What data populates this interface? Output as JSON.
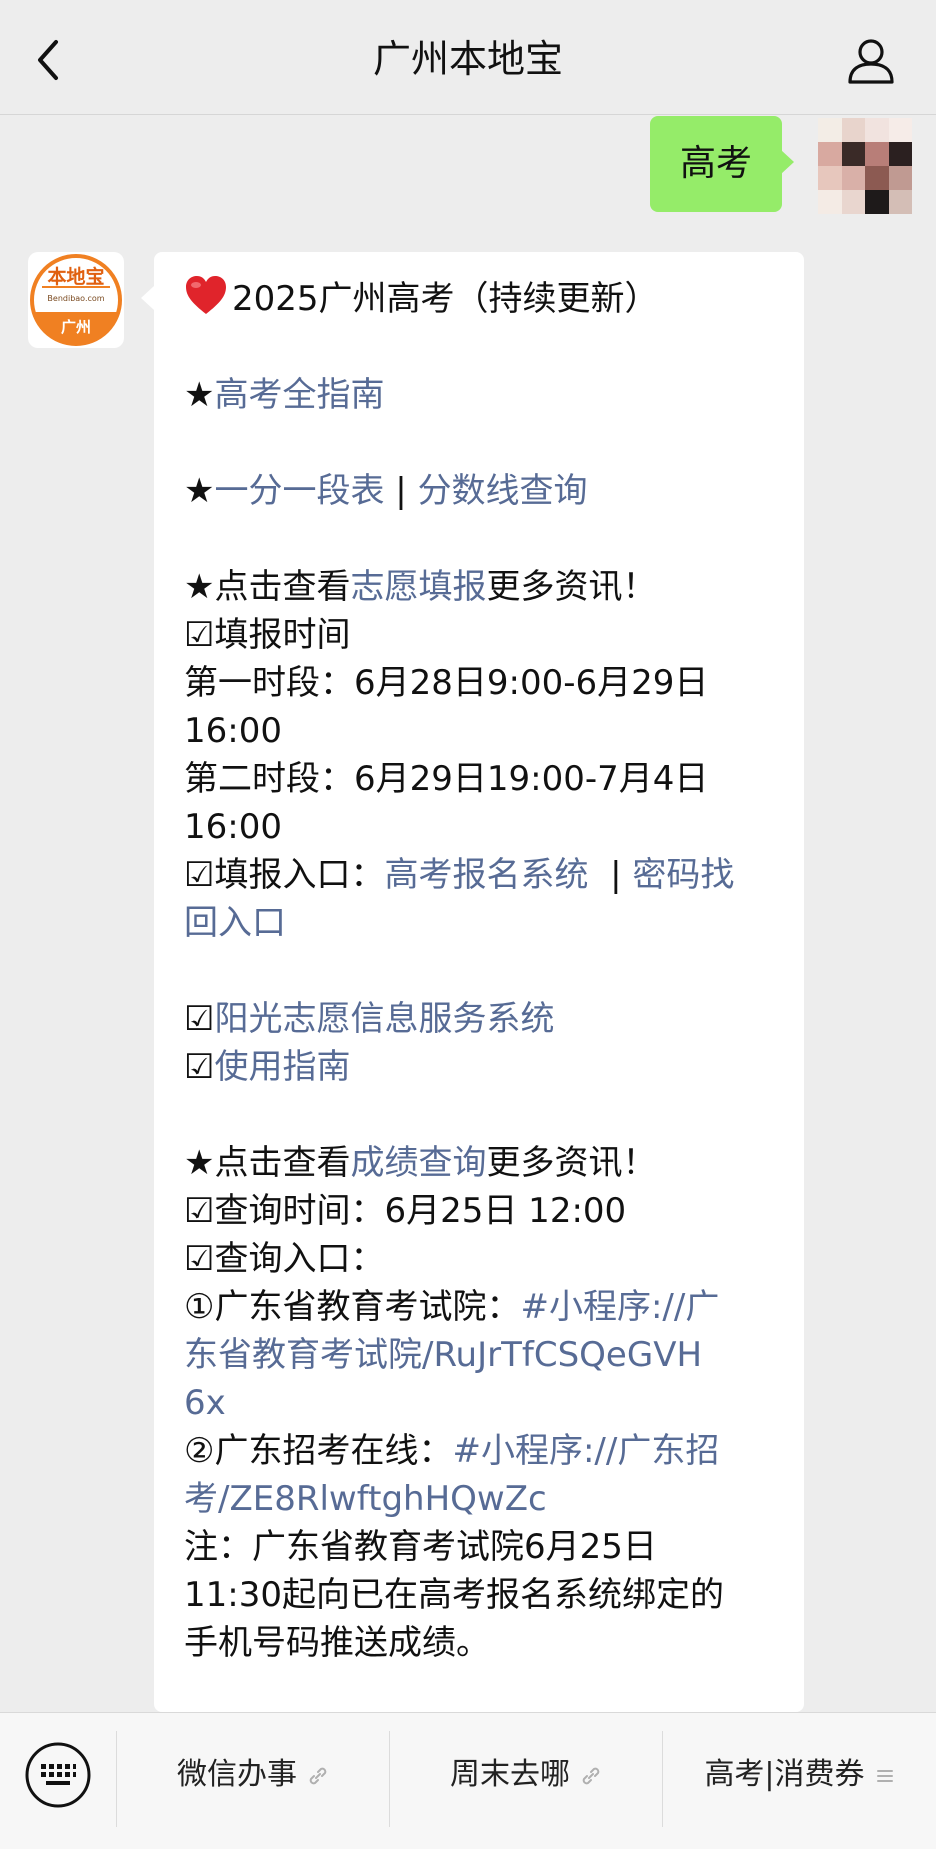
{
  "header": {
    "title": "广州本地宝",
    "back_icon": "chevron-left-icon",
    "profile_icon": "person-icon"
  },
  "user_message": {
    "text": "高考",
    "bubble_color": "#95ec69"
  },
  "reply": {
    "heading": "2025广州高考（持续更新）",
    "star": "★",
    "check": "☑",
    "guide_link": "高考全指南",
    "score_table_link": "一分一段表",
    "separator": " | ",
    "score_line_link": "分数线查询",
    "click_view": "点击查看",
    "more_info": "更多资讯！",
    "volunteer_link": "志愿填报",
    "fill_time_label": "填报时间",
    "period1_line1": "第一时段：6月28日9:00-6月29日",
    "period1_line2": "16:00",
    "period2_line1": "第二时段：6月29日19:00-7月4日",
    "period2_line2": "16:00",
    "entry_label": "填报入口：",
    "signup_system_link": "高考报名系统",
    "entry_separator": "  | ",
    "password_link_line1": "密码找",
    "password_link_line2": "回入口",
    "sunshine_link": "阳光志愿信息服务系统",
    "usage_guide_link": "使用指南",
    "score_query_link": "成绩查询",
    "query_time": "查询时间：6月25日 12:00",
    "query_entry": "查询入口：",
    "item1_prefix": "①广东省教育考试院：",
    "item1_link_line1": "#小程序://广",
    "item1_link_line2": "东省教育考试院/RuJrTfCSQeGVH",
    "item1_link_line3": "6x",
    "item2_prefix": "②广东招考在线：",
    "item2_link_line1": "#小程序://广东招",
    "item2_link_line2": "考/ZE8RlwftghHQwZc",
    "note_line1": "注：广东省教育考试院6月25日",
    "note_line2": "11:30起向已在高考报名系统绑定的",
    "note_line3": "手机号码推送成绩。",
    "link_color": "#576b95"
  },
  "official_account_avatar": {
    "logo_text": "本地宝",
    "domain_text": "Bendibao.com",
    "city_text": "广州",
    "accent_color": "#f08022"
  },
  "bottom_menu": {
    "keyboard_icon": "keyboard-icon",
    "items": [
      {
        "label": "微信办事",
        "icon": "link-icon"
      },
      {
        "label": "周末去哪",
        "icon": "link-icon"
      },
      {
        "label": "高考|消费券",
        "icon": "menu-lines-icon"
      }
    ]
  }
}
